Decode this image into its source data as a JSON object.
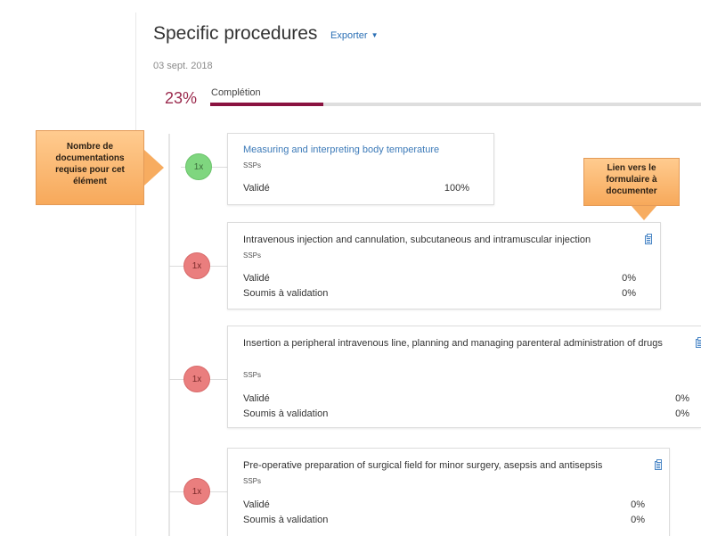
{
  "header": {
    "title": "Specific procedures",
    "export_label": "Exporter",
    "date": "03 sept. 2018"
  },
  "progress": {
    "percent_label": "23%",
    "label": "Complétion",
    "value": 0.23
  },
  "items": [
    {
      "node_label": "1x",
      "status": "complete",
      "title": "Measuring and interpreting body temperature",
      "title_is_link": true,
      "subtitle": "SSPs",
      "rows": [
        {
          "label": "Validé",
          "value": "100%"
        }
      ]
    },
    {
      "node_label": "1x",
      "status": "incomplete",
      "title": "Intravenous injection and cannulation, subcutaneous and intramuscular injection",
      "subtitle": "SSPs",
      "rows": [
        {
          "label": "Validé",
          "value": "0%"
        },
        {
          "label": "Soumis à validation",
          "value": "0%"
        }
      ]
    },
    {
      "node_label": "1x",
      "status": "incomplete",
      "title": "Insertion a peripheral intravenous line, planning and managing parenteral administration of drugs",
      "subtitle": "SSPs",
      "rows": [
        {
          "label": "Validé",
          "value": "0%"
        },
        {
          "label": "Soumis à validation",
          "value": "0%"
        }
      ]
    },
    {
      "node_label": "1x",
      "status": "incomplete",
      "title": "Pre-operative preparation of surgical field for minor surgery, asepsis and antisepsis",
      "subtitle": "SSPs",
      "rows": [
        {
          "label": "Validé",
          "value": "0%"
        },
        {
          "label": "Soumis à validation",
          "value": "0%"
        }
      ]
    }
  ],
  "annotations": {
    "left_callout": "Nombre de documentations requise pour cet élément",
    "right_callout": "Lien vers le formulaire à documenter"
  },
  "colors": {
    "accent": "#8a1340",
    "link": "#3c7ab8",
    "node_complete": "#7fd67f",
    "node_incomplete": "#ea7e7e",
    "callout": "#f7a95b"
  },
  "icons": {
    "export_caret": "chevron-down-icon",
    "document_link": "clipboard-icon"
  }
}
